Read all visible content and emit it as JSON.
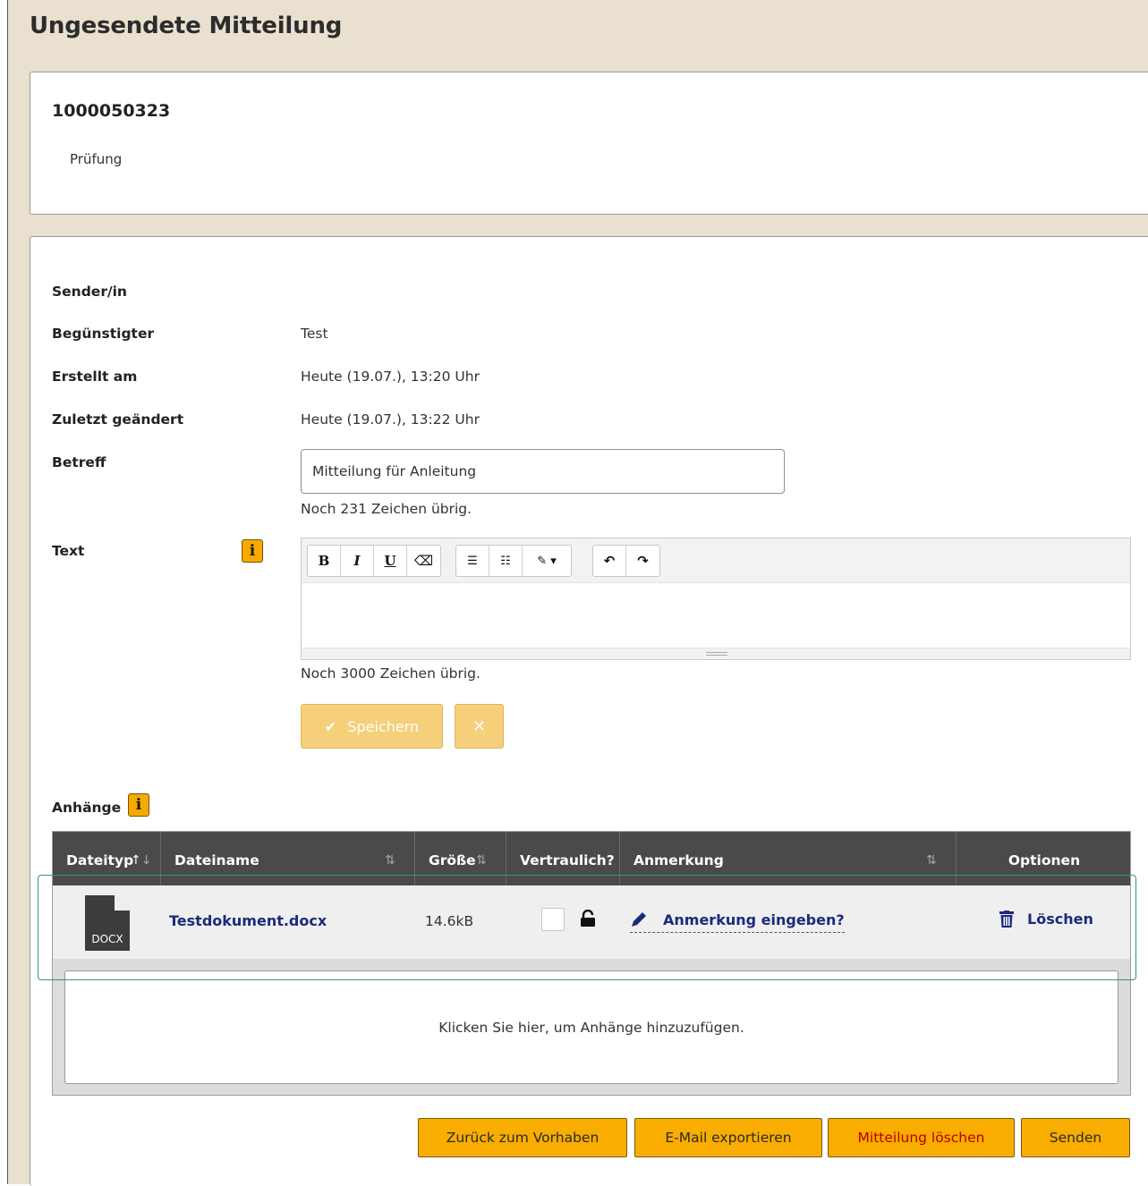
{
  "page": {
    "title": "Ungesendete Mitteilung"
  },
  "case": {
    "number": "1000050323",
    "status": "Prüfung"
  },
  "fields": {
    "sender_label": "Sender/in",
    "beneficiary_label": "Begünstigter",
    "beneficiary_value": "Test",
    "created_label": "Erstellt am",
    "created_value": "Heute (19.07.), 13:20 Uhr",
    "modified_label": "Zuletzt geändert",
    "modified_value": "Heute (19.07.), 13:22 Uhr",
    "subject_label": "Betreff",
    "subject_value": "Mitteilung für Anleitung",
    "subject_remaining": "Noch 231 Zeichen übrig.",
    "text_label": "Text",
    "text_remaining": "Noch 3000 Zeichen übrig.",
    "info_glyph": "i"
  },
  "editor": {
    "toolbar": {
      "bold": "B",
      "italic": "I",
      "underline": "U",
      "eraser": "⌫",
      "bullet_list": "☰",
      "numbered_list": "☷",
      "style": "✎ ▾",
      "undo": "↶",
      "redo": "↷"
    },
    "content": ""
  },
  "form_actions": {
    "save_label": "Speichern",
    "save_icon": "✔",
    "cancel_icon": "✕"
  },
  "attachments": {
    "label": "Anhänge",
    "columns": {
      "type": "Dateityp",
      "name": "Dateiname",
      "size": "Größe",
      "confidential": "Vertraulich?",
      "note": "Anmerkung",
      "options": "Optionen"
    },
    "rows": [
      {
        "type": "DOCX",
        "name": "Testdokument.docx",
        "size": "14.6kB",
        "confidential": false,
        "note_link": "Anmerkung eingeben?",
        "delete_label": "Löschen"
      }
    ],
    "dropzone_text": "Klicken Sie hier, um Anhänge hinzuzufügen."
  },
  "actions": {
    "back": "Zurück zum Vorhaben",
    "export": "E-Mail exportieren",
    "delete": "Mitteilung löschen",
    "send": "Senden"
  },
  "colors": {
    "accent": "#f8ad00",
    "background": "#e9e0d0",
    "link": "#1d2a7a",
    "table_header": "#4a4a4a",
    "danger_text": "#b40000",
    "highlight": "#2e9e5b"
  }
}
